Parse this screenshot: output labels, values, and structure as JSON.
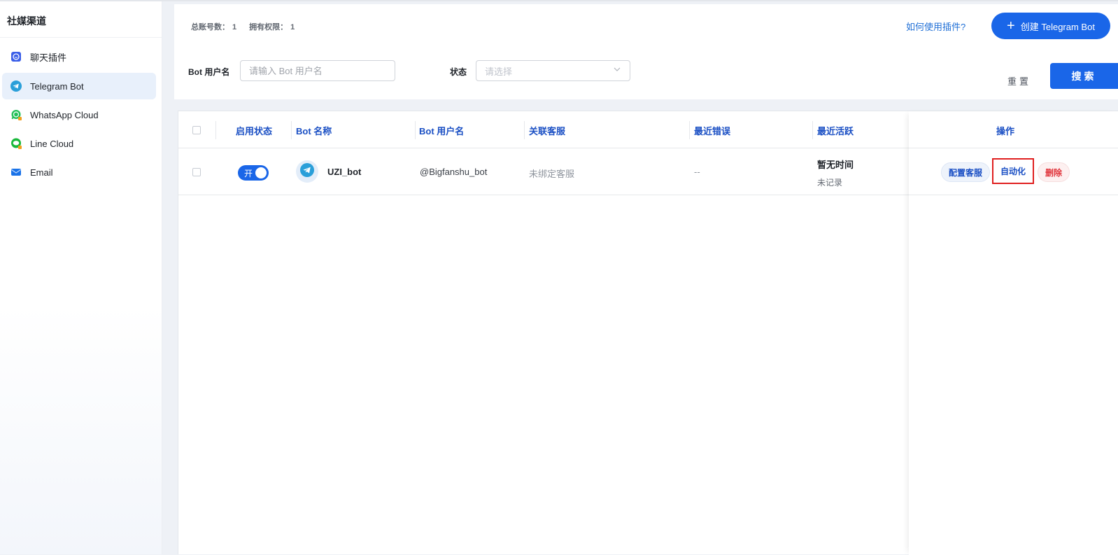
{
  "sidebar": {
    "title": "社媒渠道",
    "items": [
      {
        "label": "聊天插件",
        "icon": "chat-plugin-icon",
        "active": false
      },
      {
        "label": "Telegram Bot",
        "icon": "telegram-icon",
        "active": true
      },
      {
        "label": "WhatsApp Cloud",
        "icon": "whatsapp-icon",
        "active": false
      },
      {
        "label": "Line Cloud",
        "icon": "line-icon",
        "active": false
      },
      {
        "label": "Email",
        "icon": "email-icon",
        "active": false
      }
    ]
  },
  "header": {
    "stats": {
      "total_label": "总账号数：",
      "total_value": "1",
      "perm_label": "拥有权限：",
      "perm_value": "1"
    },
    "help_link": "如何使用插件?",
    "create_button": "创建 Telegram Bot"
  },
  "filters": {
    "username_label": "Bot 用户名",
    "username_placeholder": "请输入 Bot 用户名",
    "status_label": "状态",
    "status_placeholder": "请选择",
    "reset_label": "重置",
    "search_label": "搜索"
  },
  "table": {
    "columns": {
      "status": "启用状态",
      "name": "Bot 名称",
      "username": "Bot 用户名",
      "customer_service": "关联客服",
      "last_error": "最近错误",
      "last_active": "最近活跃",
      "actions": "操作"
    },
    "rows": [
      {
        "toggle_label": "开",
        "enabled": true,
        "name": "UZI_bot",
        "username": "@Bigfanshu_bot",
        "customer_service": "未绑定客服",
        "last_error": "--",
        "last_active_title": "暂无时间",
        "last_active_sub": "未记录",
        "actions": {
          "configure": "配置客服",
          "automation": "自动化",
          "delete": "删除"
        }
      }
    ]
  },
  "colors": {
    "primary": "#1a66e8",
    "header_text": "#1a4fc4",
    "danger": "#e0343b",
    "highlight_border": "#e02020"
  }
}
